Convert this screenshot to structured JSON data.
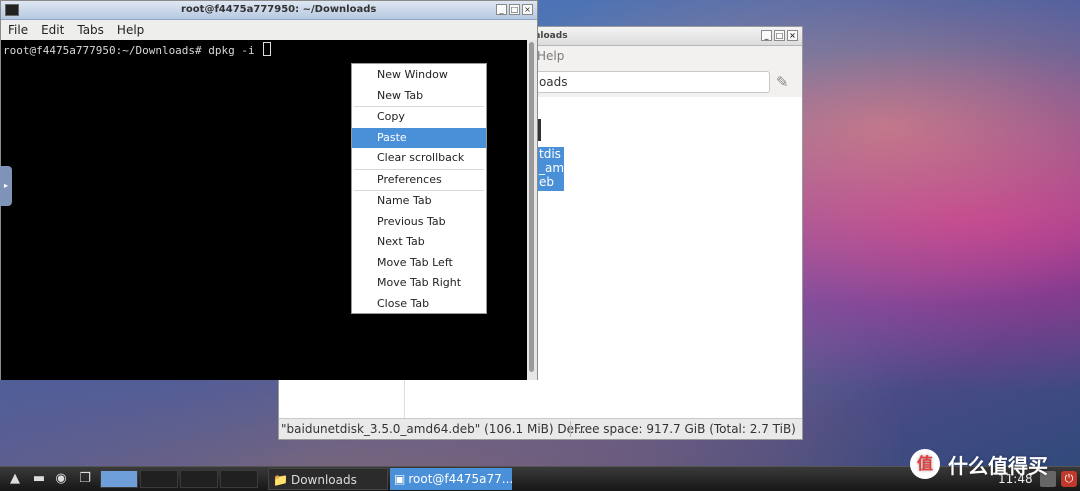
{
  "file_manager": {
    "title": "nloads",
    "menu_help": "Help",
    "path_value": "nloads",
    "selected_file_lines": [
      "tdis",
      "_am",
      "eb"
    ],
    "status_left": "\"baidunetdisk_3.5.0_amd64.deb\" (106.1 MiB) De...",
    "status_right": "Free space: 917.7 GiB (Total: 2.7 TiB)"
  },
  "terminal": {
    "title": "root@f4475a777950: ~/Downloads",
    "menu": [
      "File",
      "Edit",
      "Tabs",
      "Help"
    ],
    "prompt": "root@f4475a777950:~/Downloads# dpkg -i "
  },
  "context_menu": {
    "groups": [
      [
        "New Window",
        "New Tab"
      ],
      [
        "Copy",
        "Paste",
        "Clear scrollback"
      ],
      [
        "Preferences"
      ],
      [
        "Name Tab",
        "Previous Tab",
        "Next Tab",
        "Move Tab Left",
        "Move Tab Right",
        "Close Tab"
      ]
    ],
    "active_item": "Paste"
  },
  "taskbar": {
    "tasks": [
      {
        "label": "Downloads",
        "icon": "folder-icon"
      },
      {
        "label": "root@f4475a77...",
        "icon": "terminal-icon"
      }
    ],
    "clock": "11:48"
  },
  "watermark": {
    "badge": "值",
    "text": "什么值得买"
  },
  "colors": {
    "selection": "#4a90d9",
    "terminal_bg": "#000000"
  }
}
